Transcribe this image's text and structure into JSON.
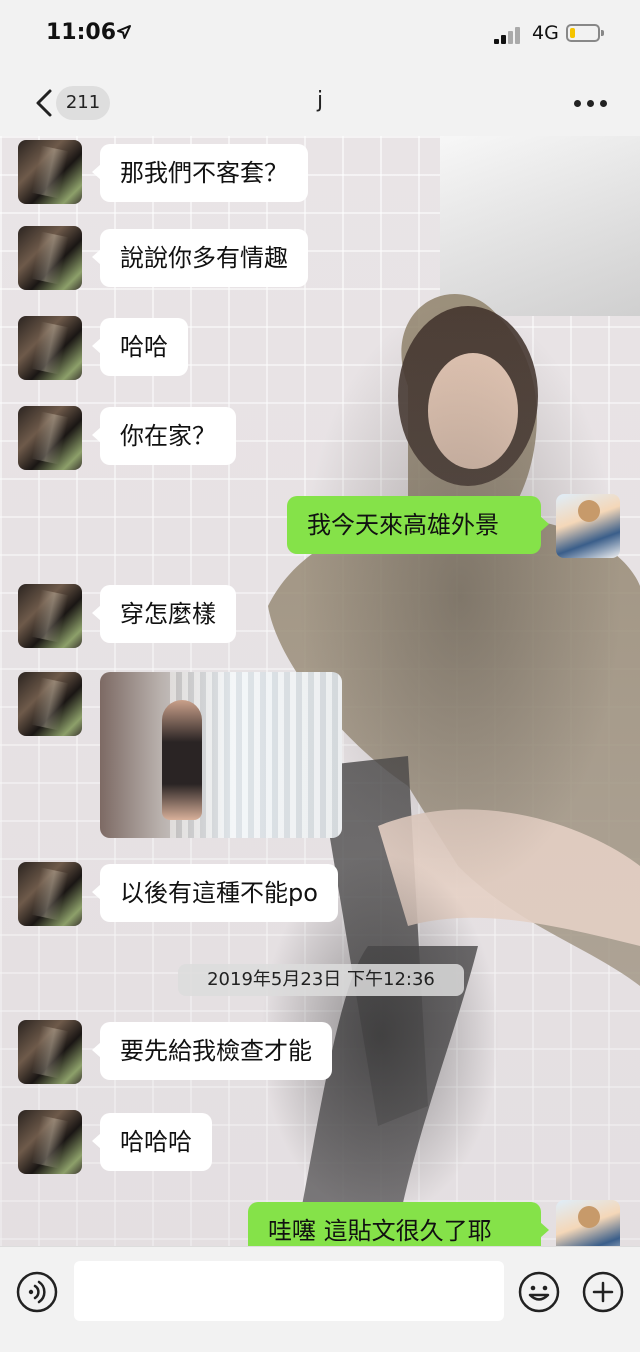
{
  "status_bar": {
    "time": "11:06",
    "location_icon": "location-arrow-icon",
    "network": "4G",
    "battery_level": 0.2,
    "battery_color": "#f5c400"
  },
  "header": {
    "back_icon": "chevron-left-icon",
    "unread_count": "211",
    "title": "j",
    "more_icon": "more-dots-icon"
  },
  "messages": [
    {
      "side": "in",
      "text": "那我們不客套？"
    },
    {
      "side": "in",
      "text": "說說你多有情趣"
    },
    {
      "side": "in",
      "text": "哈哈"
    },
    {
      "side": "in",
      "text": "你在家？"
    },
    {
      "side": "out",
      "text": "我今天來高雄外景"
    },
    {
      "side": "in",
      "text": "穿怎麼樣"
    },
    {
      "side": "in",
      "type": "image"
    },
    {
      "side": "in",
      "text": "以後有這種不能po"
    },
    {
      "type": "timestamp",
      "text": "2019年5月23日 下午12:36"
    },
    {
      "side": "in",
      "text": "要先給我檢查才能"
    },
    {
      "side": "in",
      "text": "哈哈哈"
    },
    {
      "side": "out",
      "text": "哇噻 這貼文很久了耶"
    }
  ],
  "input_bar": {
    "voice_icon": "voice-icon",
    "placeholder": "",
    "emoji_icon": "emoji-icon",
    "add_icon": "plus-icon"
  },
  "colors": {
    "outgoing_bubble": "#85e249",
    "incoming_bubble": "#ffffff",
    "header_bg": "#f2f2f2"
  }
}
